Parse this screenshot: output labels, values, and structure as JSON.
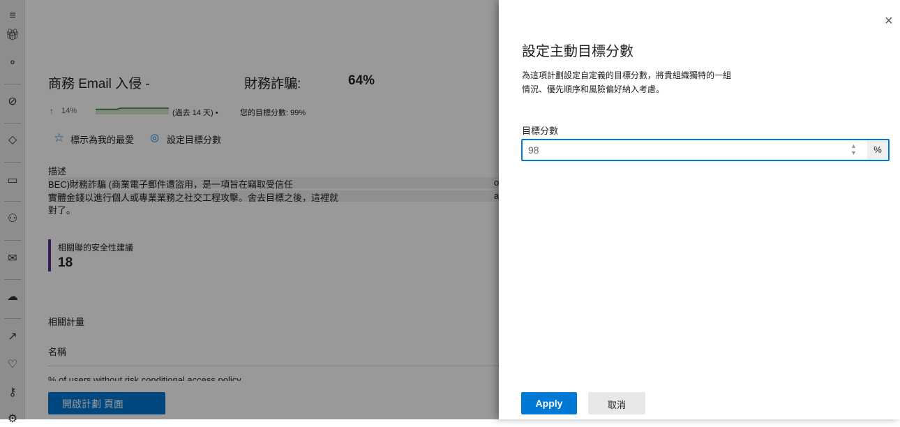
{
  "sidebar": {
    "items": [
      {
        "icon": "menu-icon"
      },
      {
        "icon": "gift-icon"
      },
      {
        "icon": "graph-icon"
      },
      {
        "icon": "compass-icon"
      },
      {
        "icon": "shapes-icon"
      },
      {
        "icon": "device-shield-icon"
      },
      {
        "icon": "person-icon"
      },
      {
        "icon": "mail-icon"
      },
      {
        "icon": "cloud-icon"
      },
      {
        "icon": "chart-icon"
      },
      {
        "icon": "heart-pulse-icon"
      },
      {
        "icon": "key-icon"
      },
      {
        "icon": "gear-icon"
      }
    ]
  },
  "main": {
    "title": "商務 Email 入侵 -",
    "title2": "財務詐騙:",
    "score": "64%",
    "trend": "14%",
    "trend_period": "(過去 14 天) •",
    "target": "您的目標分數: 99%",
    "favorite_label": "標示為我的最愛",
    "set_target_label": "設定目標分數",
    "description_heading": "描述",
    "description_lines": [
      "BEC)財務詐騙 (商業電子郵件遭盜用，是一項旨在竊取受信任",
      "實體金錢以進行個人或專業業務之社交工程攻擊。舍去目標之後，這裡就",
      "對了。"
    ],
    "description_trunc": [
      "o",
      "a"
    ],
    "recommendations_label": "相關聯的安全性建議",
    "recommendations_count": "18",
    "metrics_heading": "相關計量",
    "column_name": "名稱",
    "metric_row": "% of users without risk conditional access policy",
    "open_plan_button": "開啟計劃 頁面",
    "accent": "#004e8c"
  },
  "panel": {
    "title": "設定主動目標分數",
    "description_lines": [
      "為這項計劃設定自定義的目標分數，將貴組織獨特的一組",
      "情況、優先順序和風險偏好納入考慮。"
    ],
    "field_label": "目標分數",
    "field_value": "98",
    "unit": "%",
    "apply_label": "Apply",
    "cancel_label": "取消",
    "accent": "#0078d4"
  }
}
